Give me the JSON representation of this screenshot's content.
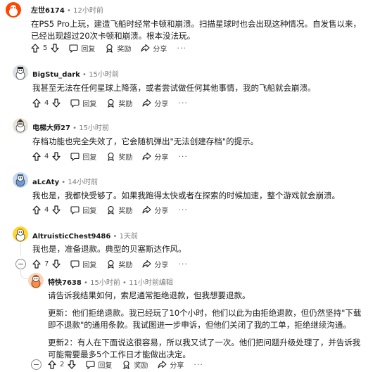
{
  "comments": [
    {
      "user": "左世6174",
      "time": "12小时前",
      "edited": "",
      "body": "在PS5 Pro上玩，建造飞船时经常卡顿和崩溃。扫描星球时也会出现这种情况。自发售以来，已经出现超过20次卡顿和崩溃。根本没法玩。",
      "votes": "5"
    },
    {
      "user": "BigStu_dark",
      "time": "15小时前",
      "edited": "",
      "body": "我甚至无法在任何星球上降落，或者尝试做任何其他事情，我的飞船就会崩溃。",
      "votes": "4"
    },
    {
      "user": "电梯大师27",
      "time": "15小时前",
      "edited": "",
      "body": "存档功能也完全失效了，它会随机弹出\"无法创建存档\"的提示。",
      "votes": "4"
    },
    {
      "user": "aLcAty",
      "time": "14小时前",
      "edited": "",
      "body": "我也是，我都快受够了。如果我跑得太快或者在探索的时候加速，整个游戏就会崩溃。",
      "votes": "4"
    },
    {
      "user": "AltruisticChest9486",
      "time": "1天前",
      "edited": "",
      "body": "我也是，准备退款。典型的贝塞斯达作风。",
      "votes": "7"
    },
    {
      "user": "特快7638",
      "time": "15小时前",
      "edited": "11小时前编辑",
      "body": "请告诉我结果如何，索尼通常拒绝退款，但我想要退款。",
      "body2": "更新：他们拒绝退款。我已经玩了10个小时，他们以此为由拒绝退款，但仍然坚持\"下载即不退款\"的通用条款。我试图进一步申诉，但他们关闭了我的工单，拒绝继续沟通。",
      "body3": "更新2：有人在下面说这很容易，所以我又试了一次。他们把问题升级处理了，并告诉我可能需要最多5个工作日才能做出决定。",
      "votes": "2"
    }
  ],
  "actions": {
    "reply": "回复",
    "award": "奖励",
    "share": "分享",
    "more": "···"
  },
  "separator": "•",
  "colors": {
    "upvote_icon": "#1a1a1b",
    "meta_text": "#7c7c7c",
    "thread_line": "#e5e5e5"
  }
}
